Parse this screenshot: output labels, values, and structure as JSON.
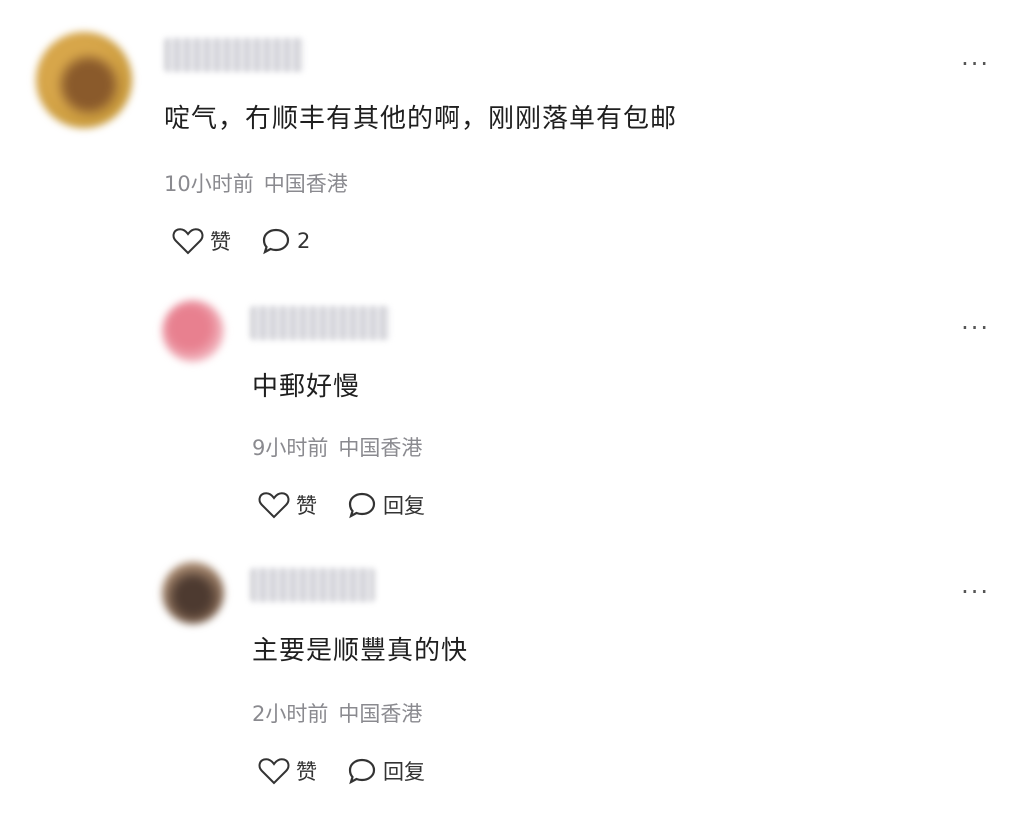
{
  "comments": [
    {
      "text": "啶气，冇顺丰有其他的啊，刚刚落单有包邮",
      "time": "10小时前",
      "location": "中国香港",
      "like_label": "赞",
      "reply_count": "2",
      "more_label": "···"
    },
    {
      "text": "中郵好慢",
      "time": "9小时前",
      "location": "中国香港",
      "like_label": "赞",
      "reply_label": "回复",
      "more_label": "···"
    },
    {
      "text": "主要是顺豐真的快",
      "time": "2小时前",
      "location": "中国香港",
      "like_label": "赞",
      "reply_label": "回复",
      "more_label": "···"
    }
  ]
}
